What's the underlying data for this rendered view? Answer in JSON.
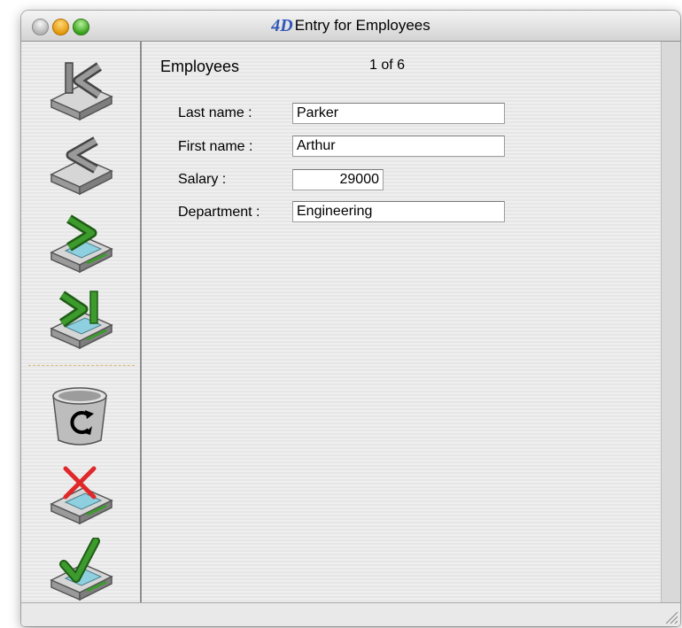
{
  "window": {
    "app_logo": "4D",
    "title": "Entry for Employees"
  },
  "toolbar": {
    "buttons": [
      {
        "name": "first-record",
        "icon": "first-record-icon"
      },
      {
        "name": "previous-record",
        "icon": "previous-record-icon"
      },
      {
        "name": "next-record",
        "icon": "next-record-icon"
      },
      {
        "name": "last-record",
        "icon": "last-record-icon"
      },
      {
        "name": "delete-record",
        "icon": "trash-icon"
      },
      {
        "name": "cancel",
        "icon": "cancel-icon"
      },
      {
        "name": "accept",
        "icon": "accept-icon"
      }
    ]
  },
  "form": {
    "table_name": "Employees",
    "record_counter": "1 of 6",
    "fields": {
      "last_name": {
        "label": "Last name :",
        "value": "Parker"
      },
      "first_name": {
        "label": "First name :",
        "value": "Arthur"
      },
      "salary": {
        "label": "Salary :",
        "value": "29000"
      },
      "department": {
        "label": "Department :",
        "value": "Engineering"
      }
    }
  },
  "colors": {
    "arrow_green": "#3c9b2c",
    "cancel_red": "#e0282a",
    "logo_blue": "#2f56b8"
  }
}
